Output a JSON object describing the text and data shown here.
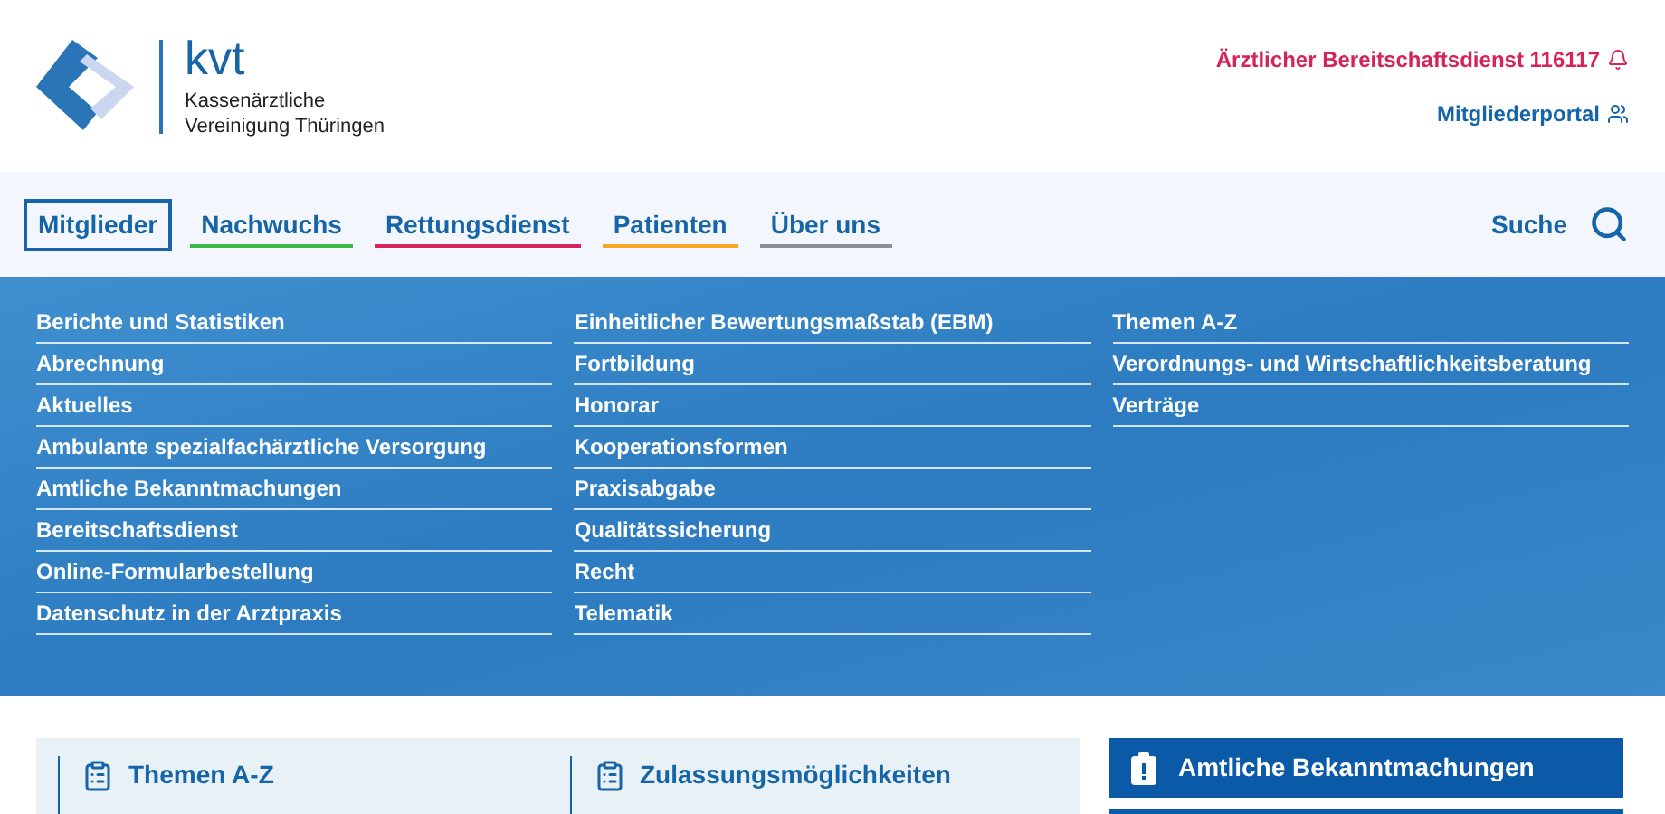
{
  "logo": {
    "short": "kvt",
    "line1": "Kassenärztliche",
    "line2": "Vereinigung Thüringen"
  },
  "top_links": [
    {
      "label": "Ärztlicher Bereitschaftsdienst 116117",
      "kind": "alert"
    },
    {
      "label": "Mitgliederportal",
      "kind": "portal"
    }
  ],
  "nav": {
    "tabs": [
      {
        "label": "Mitglieder",
        "selected": true,
        "color": "#1565a8"
      },
      {
        "label": "Nachwuchs",
        "selected": false,
        "color": "#3bb54a"
      },
      {
        "label": "Rettungsdienst",
        "selected": false,
        "color": "#d6245a"
      },
      {
        "label": "Patienten",
        "selected": false,
        "color": "#f5a623"
      },
      {
        "label": "Über uns",
        "selected": false,
        "color": "#8a8f98"
      }
    ],
    "search_label": "Suche"
  },
  "mega_menu": {
    "columns": [
      [
        "Berichte und Statistiken",
        "Abrechnung",
        "Aktuelles",
        "Ambulante spezialfachärztliche Versorgung",
        "Amtliche Bekanntmachungen",
        "Bereitschaftsdienst",
        "Online-Formularbestellung",
        "Datenschutz in der Arztpraxis"
      ],
      [
        "Einheitlicher Bewertungsmaßstab (EBM)",
        "Fortbildung",
        "Honorar",
        "Kooperationsformen",
        "Praxisabgabe",
        "Qualitätssicherung",
        "Recht",
        "Telematik"
      ],
      [
        "Themen A-Z",
        "Verordnungs- und Wirtschaftlichkeitsberatung",
        "Verträge"
      ]
    ]
  },
  "teasers": [
    {
      "title": "Themen A-Z"
    },
    {
      "title": "Zulassungsmöglichkeiten"
    }
  ],
  "side_button": {
    "label": "Amtliche Bekanntmachungen"
  }
}
